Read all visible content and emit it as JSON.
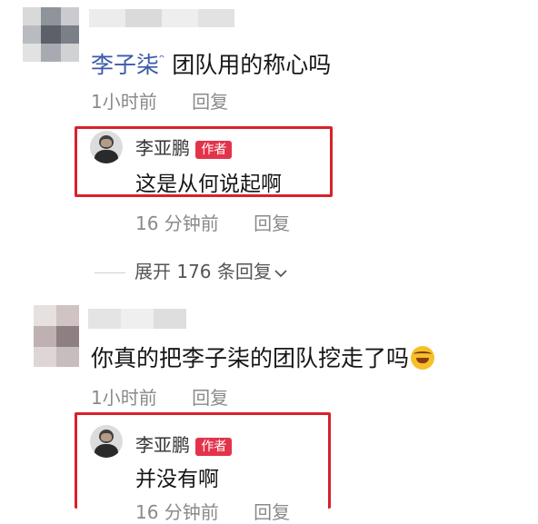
{
  "comments": [
    {
      "user": "李子柒",
      "user_suffix": "ᵔ",
      "text": "团队用的称心吗",
      "time": "1小时前",
      "reply_label": "回复",
      "author_reply": {
        "name": "李亚鹏",
        "badge": "作者",
        "text": "这是从何说起啊",
        "time": "16 分钟前",
        "reply_label": "回复"
      },
      "expand_label": "展开 176 条回复"
    },
    {
      "text": "你真的把李子柒的团队挖走了吗",
      "emoji": "laughing-tears-emoji",
      "time": "1小时前",
      "reply_label": "回复",
      "author_reply": {
        "name": "李亚鹏",
        "badge": "作者",
        "text": "并没有啊",
        "time": "16 分钟前",
        "reply_label": "回复"
      }
    }
  ],
  "colors": {
    "highlight": "#d8212b",
    "badge": "#e3334a",
    "meta": "#8a8a8a"
  }
}
